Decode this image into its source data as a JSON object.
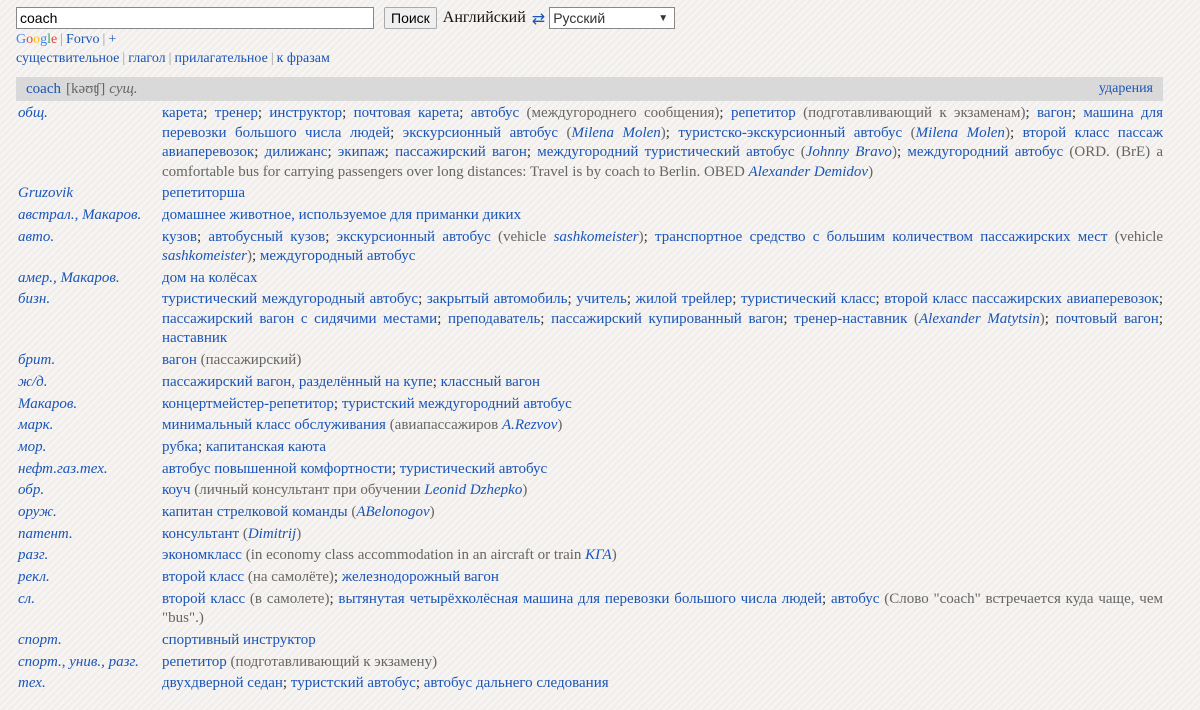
{
  "search": {
    "value": "coach",
    "button": "Поиск"
  },
  "lang": {
    "from": "Английский",
    "swap": "⇄",
    "to": "Русский"
  },
  "links": {
    "google": "Google",
    "forvo": "Forvo",
    "plus": "+"
  },
  "pos_links": [
    "существительное",
    "глагол",
    "прилагательное",
    "к фразам"
  ],
  "entry": {
    "word": "coach",
    "transcription": "[kəʊʧ]",
    "pos": "сущ.",
    "stress": "ударения"
  },
  "rows": [
    {
      "subject": "общ.",
      "parts": [
        {
          "t": "карета"
        },
        {
          "s": "; "
        },
        {
          "t": "тренер"
        },
        {
          "s": "; "
        },
        {
          "t": "инструктор"
        },
        {
          "s": "; "
        },
        {
          "t": "почтовая карета"
        },
        {
          "s": "; "
        },
        {
          "t": "автобус"
        },
        {
          "c": " (междугороднего сообщения)"
        },
        {
          "s": "; "
        },
        {
          "t": "репетитор"
        },
        {
          "c": " (подготавливающий к экзаменам)"
        },
        {
          "s": "; "
        },
        {
          "t": "вагон"
        },
        {
          "s": "; "
        },
        {
          "t": "машина для перевозки большого числа людей"
        },
        {
          "s": "; "
        },
        {
          "t": "экскурсионный автобус"
        },
        {
          "c": " (",
          "a": "Milena Molen",
          "e": ")"
        },
        {
          "s": "; "
        },
        {
          "t": "туристско-экскурсионный автобус"
        },
        {
          "c": " (",
          "a": "Milena Molen",
          "e": ")"
        },
        {
          "s": "; "
        },
        {
          "t": "второй класс пассаж авиаперевозок"
        },
        {
          "s": "; "
        },
        {
          "t": "дилижанс"
        },
        {
          "s": "; "
        },
        {
          "t": "экипаж"
        },
        {
          "s": "; "
        },
        {
          "t": "пассажирский вагон"
        },
        {
          "s": "; "
        },
        {
          "t": "междугородний туристический автобус"
        },
        {
          "c": " (",
          "a": "Johnny Bravo",
          "e": ")"
        },
        {
          "s": "; "
        },
        {
          "t": "междугородний автобус"
        },
        {
          "c": " (ORD. (BrE) a comfortable bus for carrying passengers over long distances: Travel is by coach to Berlin. OBED ",
          "a": "Alexander Demidov",
          "e": ")"
        }
      ]
    },
    {
      "subject": "Gruzovik",
      "parts": [
        {
          "t": "репетиторша"
        }
      ]
    },
    {
      "subject": "австрал., Макаров.",
      "parts": [
        {
          "t": "домашнее животное, используемое для приманки диких"
        }
      ]
    },
    {
      "subject": "авто.",
      "parts": [
        {
          "t": "кузов"
        },
        {
          "s": "; "
        },
        {
          "t": "автобусный кузов"
        },
        {
          "s": "; "
        },
        {
          "t": "экскурсионный автобус"
        },
        {
          "c": " (vehicle ",
          "a": "sashkomeister",
          "e": ")"
        },
        {
          "s": "; "
        },
        {
          "t": "транспортное средство с большим количеством пассажирских мест"
        },
        {
          "c": " (vehicle ",
          "a": "sashkomeister",
          "e": ")"
        },
        {
          "s": "; "
        },
        {
          "t": "междугородный автобус"
        }
      ]
    },
    {
      "subject": "амер., Макаров.",
      "parts": [
        {
          "t": "дом на колёсах"
        }
      ]
    },
    {
      "subject": "бизн.",
      "parts": [
        {
          "t": "туристический междугородный автобус"
        },
        {
          "s": "; "
        },
        {
          "t": "закрытый автомобиль"
        },
        {
          "s": "; "
        },
        {
          "t": "учитель"
        },
        {
          "s": "; "
        },
        {
          "t": "жилой трейлер"
        },
        {
          "s": "; "
        },
        {
          "t": "туристический класс"
        },
        {
          "s": "; "
        },
        {
          "t": "второй класс пассажирских авиаперевозок"
        },
        {
          "s": "; "
        },
        {
          "t": "пассажирский вагон с сидячими местами"
        },
        {
          "s": "; "
        },
        {
          "t": "преподаватель"
        },
        {
          "s": "; "
        },
        {
          "t": "пассажирский купированный вагон"
        },
        {
          "s": "; "
        },
        {
          "t": "тренер-наставник"
        },
        {
          "c": " (",
          "a": "Alexander Matytsin",
          "e": ")"
        },
        {
          "s": "; "
        },
        {
          "t": "почтовый вагон"
        },
        {
          "s": "; "
        },
        {
          "t": "наставник"
        }
      ]
    },
    {
      "subject": "брит.",
      "parts": [
        {
          "t": "вагон"
        },
        {
          "c": " (пассажирский)"
        }
      ]
    },
    {
      "subject": "ж/д.",
      "parts": [
        {
          "t": "пассажирский вагон, разделённый на купе"
        },
        {
          "s": "; "
        },
        {
          "t": "классный вагон"
        }
      ]
    },
    {
      "subject": "Макаров.",
      "parts": [
        {
          "t": "концертмейстер-репетитор"
        },
        {
          "s": "; "
        },
        {
          "t": "туристский междугородний автобус"
        }
      ]
    },
    {
      "subject": "марк.",
      "parts": [
        {
          "t": "минимальный класс обслуживания"
        },
        {
          "c": " (авиапассажиров ",
          "a": "A.Rezvov",
          "e": ")"
        }
      ]
    },
    {
      "subject": "мор.",
      "parts": [
        {
          "t": "рубка"
        },
        {
          "s": "; "
        },
        {
          "t": "капитанская каюта"
        }
      ]
    },
    {
      "subject": "нефт.газ.тех.",
      "parts": [
        {
          "t": "автобус повышенной комфортности"
        },
        {
          "s": "; "
        },
        {
          "t": "туристический автобус"
        }
      ]
    },
    {
      "subject": "обр.",
      "parts": [
        {
          "t": "коуч"
        },
        {
          "c": " (личный консультант при обучении ",
          "a": "Leonid Dzhepko",
          "e": ")"
        }
      ]
    },
    {
      "subject": "оруж.",
      "parts": [
        {
          "t": "капитан стрелковой команды"
        },
        {
          "c": " (",
          "a": "ABelonogov",
          "e": ")"
        }
      ]
    },
    {
      "subject": "патент.",
      "parts": [
        {
          "t": "консультант"
        },
        {
          "c": " (",
          "a": "Dimitrij",
          "e": ")"
        }
      ]
    },
    {
      "subject": "разг.",
      "parts": [
        {
          "t": "экономкласс"
        },
        {
          "c": " (in economy class accommodation in an aircraft or train ",
          "a": "КГА",
          "e": ")"
        }
      ]
    },
    {
      "subject": "рекл.",
      "parts": [
        {
          "t": "второй класс"
        },
        {
          "c": " (на самолёте)"
        },
        {
          "s": "; "
        },
        {
          "t": "железнодорожный вагон"
        }
      ]
    },
    {
      "subject": "сл.",
      "parts": [
        {
          "t": "второй класс"
        },
        {
          "c": " (в самолете)"
        },
        {
          "s": "; "
        },
        {
          "t": "вытянутая четырёхколёсная машина для перевозки большого числа людей"
        },
        {
          "s": "; "
        },
        {
          "t": "автобус"
        },
        {
          "c": " (Слово \"coach\" встречается куда чаще, чем \"bus\".)"
        }
      ]
    },
    {
      "subject": "спорт.",
      "parts": [
        {
          "t": "спортивный инструктор"
        }
      ]
    },
    {
      "subject": "спорт., унив., разг.",
      "parts": [
        {
          "t": "репетитор"
        },
        {
          "c": " (подготавливающий к экзамену)"
        }
      ]
    },
    {
      "subject": "тех.",
      "parts": [
        {
          "t": "двухдверной седан"
        },
        {
          "s": "; "
        },
        {
          "t": "туристский автобус"
        },
        {
          "s": "; "
        },
        {
          "t": "автобус дальнего следования"
        }
      ]
    }
  ]
}
